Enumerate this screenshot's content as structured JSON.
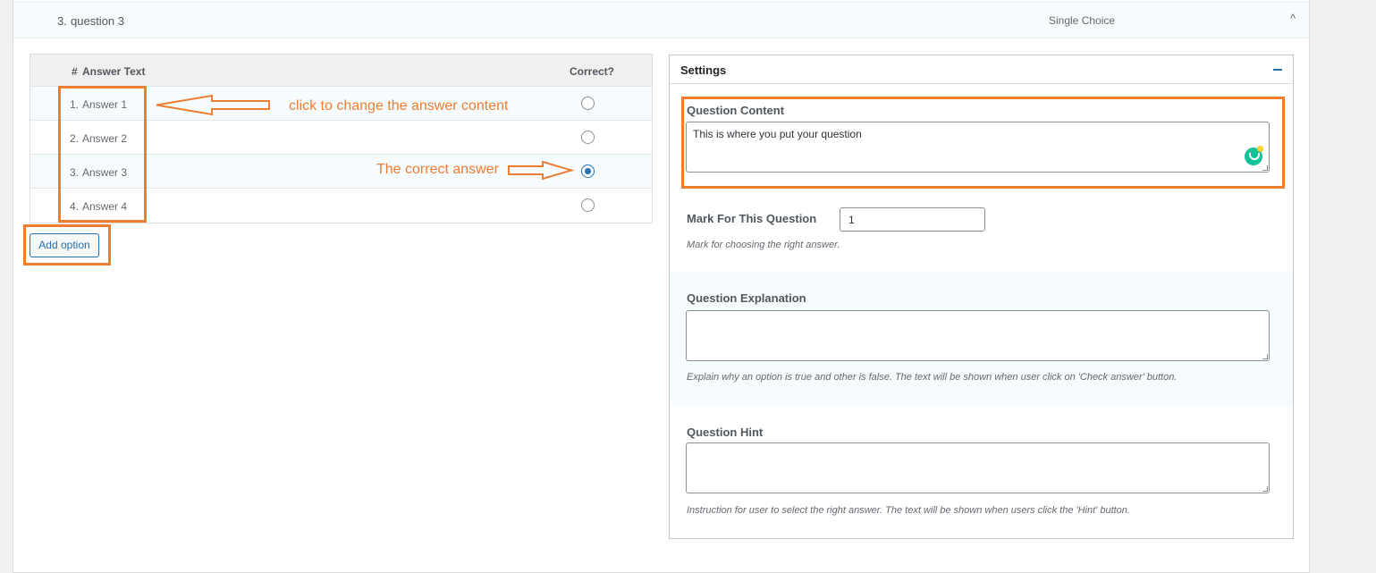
{
  "question": {
    "number": "3.",
    "title": "question 3",
    "type": "Single Choice",
    "toggle_glyph": "^"
  },
  "answers": {
    "header_number": "#",
    "header_text": "Answer Text",
    "header_correct": "Correct?",
    "rows": [
      {
        "num": "1.",
        "text": "Answer 1",
        "correct": false
      },
      {
        "num": "2.",
        "text": "Answer 2",
        "correct": false
      },
      {
        "num": "3.",
        "text": "Answer 3",
        "correct": true
      },
      {
        "num": "4.",
        "text": "Answer 4",
        "correct": false
      }
    ],
    "add_option_label": "Add option"
  },
  "annotations": {
    "answer_note": "click to change the answer content",
    "correct_note": "The correct answer",
    "color": "#ed7d31"
  },
  "settings": {
    "title": "Settings",
    "question_content": {
      "label": "Question Content",
      "value": "This is where you put your question"
    },
    "mark": {
      "label": "Mark For This Question",
      "value": "1",
      "hint": "Mark for choosing the right answer."
    },
    "explanation": {
      "label": "Question Explanation",
      "value": "",
      "hint": "Explain why an option is true and other is false. The text will be shown when user click on 'Check answer' button."
    },
    "hint": {
      "label": "Question Hint",
      "value": "",
      "hint": "Instruction for user to select the right answer. The text will be shown when users click the 'Hint' button."
    }
  },
  "colors": {
    "accent": "#2271b1",
    "grammarly": "#15c39a"
  }
}
